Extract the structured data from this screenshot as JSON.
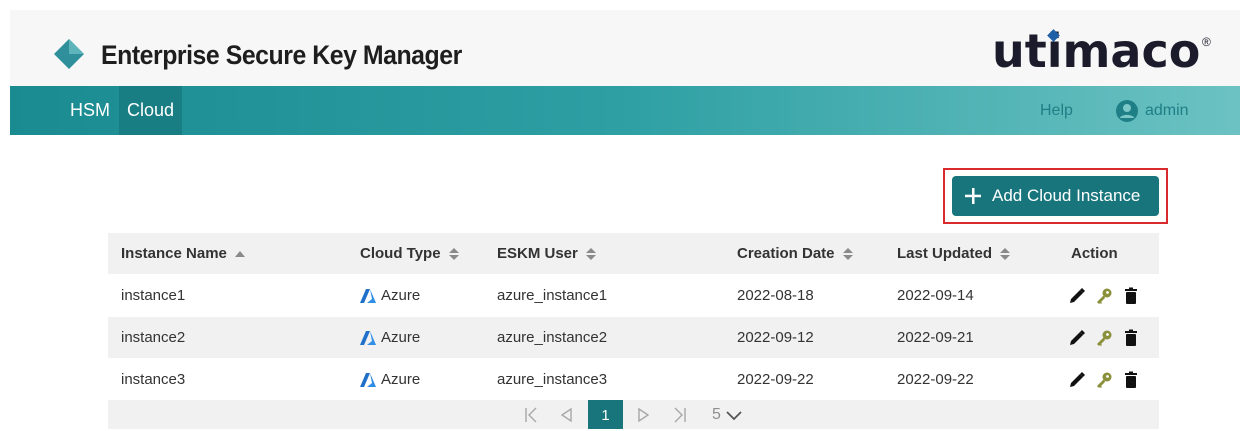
{
  "header": {
    "app_title": "Enterprise Secure Key Manager",
    "brand_name": "utimaco",
    "brand_mark": "®",
    "logo_icon": "teal-diamond-icon"
  },
  "nav": {
    "items": [
      {
        "label": "HSM",
        "active": false
      },
      {
        "label": "Cloud",
        "active": true
      }
    ],
    "help_label": "Help",
    "user_label": "admin",
    "user_icon": "user-circle-icon"
  },
  "toolbar": {
    "add_label": "Add Cloud Instance"
  },
  "table": {
    "columns": [
      {
        "label": "Instance Name",
        "sort": "asc"
      },
      {
        "label": "Cloud Type",
        "sort": "both"
      },
      {
        "label": "ESKM User",
        "sort": "both"
      },
      {
        "label": "Creation Date",
        "sort": "both"
      },
      {
        "label": "Last Updated",
        "sort": "both"
      },
      {
        "label": "Action",
        "sort": "none"
      }
    ],
    "rows": [
      {
        "instance": "instance1",
        "cloud": "Azure",
        "user": "azure_instance1",
        "created": "2022-08-18",
        "updated": "2022-09-14"
      },
      {
        "instance": "instance2",
        "cloud": "Azure",
        "user": "azure_instance2",
        "created": "2022-09-12",
        "updated": "2022-09-21"
      },
      {
        "instance": "instance3",
        "cloud": "Azure",
        "user": "azure_instance3",
        "created": "2022-09-22",
        "updated": "2022-09-22"
      }
    ],
    "action_icons": [
      "pencil-icon",
      "key-icon",
      "trash-icon"
    ]
  },
  "pager": {
    "current_page": "1",
    "page_size": "5"
  },
  "colors": {
    "accent": "#18757c",
    "highlight": "#d92b2b"
  }
}
